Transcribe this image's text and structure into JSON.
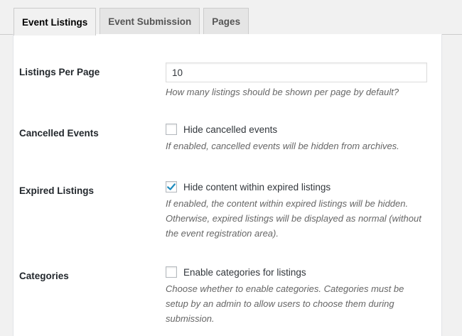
{
  "tabs": [
    {
      "label": "Event Listings",
      "active": true
    },
    {
      "label": "Event Submission",
      "active": false
    },
    {
      "label": "Pages",
      "active": false
    }
  ],
  "settings": {
    "listings_per_page": {
      "label": "Listings Per Page",
      "value": "10",
      "description": "How many listings should be shown per page by default?"
    },
    "cancelled_events": {
      "label": "Cancelled Events",
      "checkbox_label": "Hide cancelled events",
      "checked": false,
      "description": "If enabled, cancelled events will be hidden from archives."
    },
    "expired_listings": {
      "label": "Expired Listings",
      "checkbox_label": "Hide content within expired listings",
      "checked": true,
      "description": "If enabled, the content within expired listings will be hidden. Otherwise, expired listings will be displayed as normal (without the event registration area)."
    },
    "categories": {
      "label": "Categories",
      "checkbox_label": "Enable categories for listings",
      "checked": false,
      "description": "Choose whether to enable categories. Categories must be setup by an admin to allow users to choose them during submission."
    }
  },
  "colors": {
    "check_mark": "#1e8cbe",
    "page_background": "#f1f1f1",
    "panel_background": "#ffffff"
  }
}
